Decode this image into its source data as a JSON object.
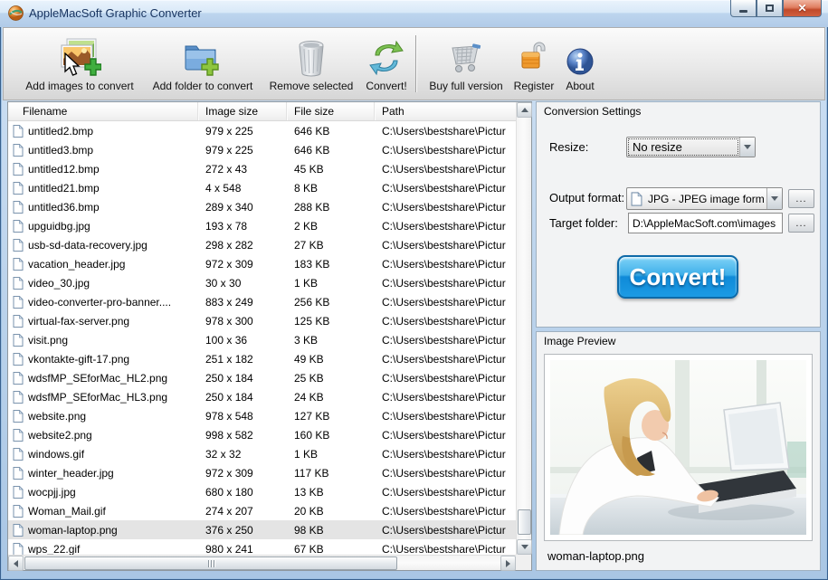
{
  "window": {
    "title": "AppleMacSoft Graphic Converter"
  },
  "toolbar": {
    "buttons": [
      {
        "label": "Add images to convert",
        "icon": "add-images-icon"
      },
      {
        "label": "Add folder to convert",
        "icon": "add-folder-icon"
      },
      {
        "label": "Remove selected",
        "icon": "trash-icon"
      },
      {
        "label": "Convert!",
        "icon": "convert-arrows-icon"
      },
      {
        "label": "Buy full version",
        "icon": "shopping-cart-icon"
      },
      {
        "label": "Register",
        "icon": "padlock-icon"
      },
      {
        "label": "About",
        "icon": "info-icon"
      }
    ]
  },
  "table": {
    "columns": [
      "Filename",
      "Image size",
      "File size",
      "Path"
    ],
    "rows": [
      {
        "name": "untitled2.bmp",
        "image_size": "979 x 225",
        "file_size": "646 KB",
        "path": "C:\\Users\\bestshare\\Pictur"
      },
      {
        "name": "untitled3.bmp",
        "image_size": "979 x 225",
        "file_size": "646 KB",
        "path": "C:\\Users\\bestshare\\Pictur"
      },
      {
        "name": "untitled12.bmp",
        "image_size": "272 x 43",
        "file_size": "45 KB",
        "path": "C:\\Users\\bestshare\\Pictur"
      },
      {
        "name": "untitled21.bmp",
        "image_size": "4 x 548",
        "file_size": "8 KB",
        "path": "C:\\Users\\bestshare\\Pictur"
      },
      {
        "name": "untitled36.bmp",
        "image_size": "289 x 340",
        "file_size": "288 KB",
        "path": "C:\\Users\\bestshare\\Pictur"
      },
      {
        "name": "upguidbg.jpg",
        "image_size": "193 x 78",
        "file_size": "2 KB",
        "path": "C:\\Users\\bestshare\\Pictur"
      },
      {
        "name": "usb-sd-data-recovery.jpg",
        "image_size": "298 x 282",
        "file_size": "27 KB",
        "path": "C:\\Users\\bestshare\\Pictur"
      },
      {
        "name": "vacation_header.jpg",
        "image_size": "972 x 309",
        "file_size": "183 KB",
        "path": "C:\\Users\\bestshare\\Pictur"
      },
      {
        "name": "video_30.jpg",
        "image_size": "30 x 30",
        "file_size": "1 KB",
        "path": "C:\\Users\\bestshare\\Pictur"
      },
      {
        "name": "video-converter-pro-banner....",
        "image_size": "883 x 249",
        "file_size": "256 KB",
        "path": "C:\\Users\\bestshare\\Pictur"
      },
      {
        "name": "virtual-fax-server.png",
        "image_size": "978 x 300",
        "file_size": "125 KB",
        "path": "C:\\Users\\bestshare\\Pictur"
      },
      {
        "name": "visit.png",
        "image_size": "100 x 36",
        "file_size": "3 KB",
        "path": "C:\\Users\\bestshare\\Pictur"
      },
      {
        "name": "vkontakte-gift-17.png",
        "image_size": "251 x 182",
        "file_size": "49 KB",
        "path": "C:\\Users\\bestshare\\Pictur"
      },
      {
        "name": "wdsfMP_SEforMac_HL2.png",
        "image_size": "250 x 184",
        "file_size": "25 KB",
        "path": "C:\\Users\\bestshare\\Pictur"
      },
      {
        "name": "wdsfMP_SEforMac_HL3.png",
        "image_size": "250 x 184",
        "file_size": "24 KB",
        "path": "C:\\Users\\bestshare\\Pictur"
      },
      {
        "name": "website.png",
        "image_size": "978 x 548",
        "file_size": "127 KB",
        "path": "C:\\Users\\bestshare\\Pictur"
      },
      {
        "name": "website2.png",
        "image_size": "998 x 582",
        "file_size": "160 KB",
        "path": "C:\\Users\\bestshare\\Pictur"
      },
      {
        "name": "windows.gif",
        "image_size": "32 x 32",
        "file_size": "1 KB",
        "path": "C:\\Users\\bestshare\\Pictur"
      },
      {
        "name": "winter_header.jpg",
        "image_size": "972 x 309",
        "file_size": "117 KB",
        "path": "C:\\Users\\bestshare\\Pictur"
      },
      {
        "name": "wocpjj.jpg",
        "image_size": "680 x 180",
        "file_size": "13 KB",
        "path": "C:\\Users\\bestshare\\Pictur"
      },
      {
        "name": "Woman_Mail.gif",
        "image_size": "274 x 207",
        "file_size": "20 KB",
        "path": "C:\\Users\\bestshare\\Pictur"
      },
      {
        "name": "woman-laptop.png",
        "image_size": "376 x 250",
        "file_size": "98 KB",
        "path": "C:\\Users\\bestshare\\Pictur",
        "selected": true
      },
      {
        "name": "wps_22.gif",
        "image_size": "980 x 241",
        "file_size": "67 KB",
        "path": "C:\\Users\\bestshare\\Pictur"
      }
    ]
  },
  "settings": {
    "group_title": "Conversion Settings",
    "resize_label": "Resize:",
    "resize_value": "No resize",
    "output_format_label": "Output format:",
    "output_format_value": "JPG - JPEG image form",
    "target_folder_label": "Target folder:",
    "target_folder_value": "D:\\AppleMacSoft.com\\images",
    "browse_label": "...",
    "convert_label": "Convert!"
  },
  "preview": {
    "group_title": "Image Preview",
    "caption": "woman-laptop.png"
  },
  "colors": {
    "titlebar_text": "#17335f",
    "convert_button_blue": "#1c9be4",
    "selection_gray": "#e4e4e4",
    "close_button_red": "#c14a2b"
  }
}
